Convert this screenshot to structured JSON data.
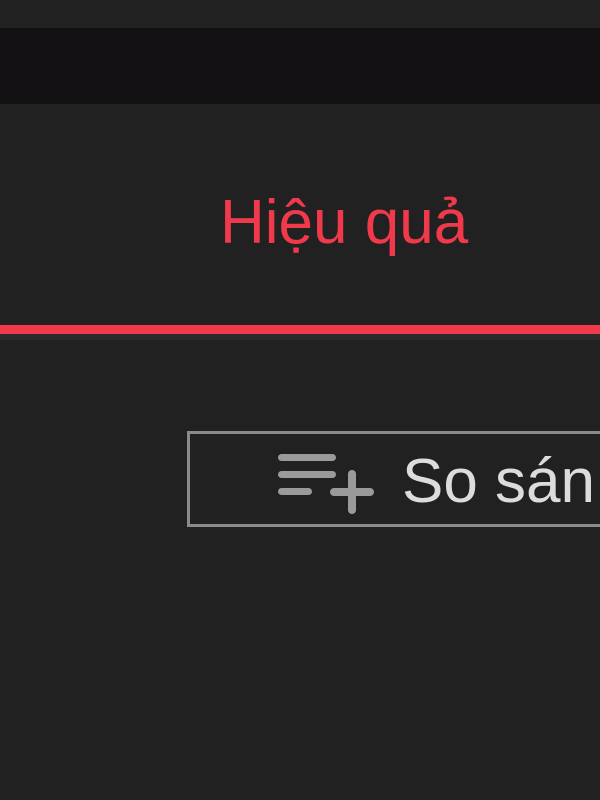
{
  "tabs": [
    {
      "label": "Hiệu quả",
      "active": true
    }
  ],
  "compare_button": {
    "label": "So sán",
    "icon": "playlist-add-icon"
  },
  "colors": {
    "background": "#212121",
    "toolbar": "#131113",
    "accent": "#f03a4c",
    "button_border": "#8a8a8a",
    "button_text": "#dcdcdc"
  }
}
